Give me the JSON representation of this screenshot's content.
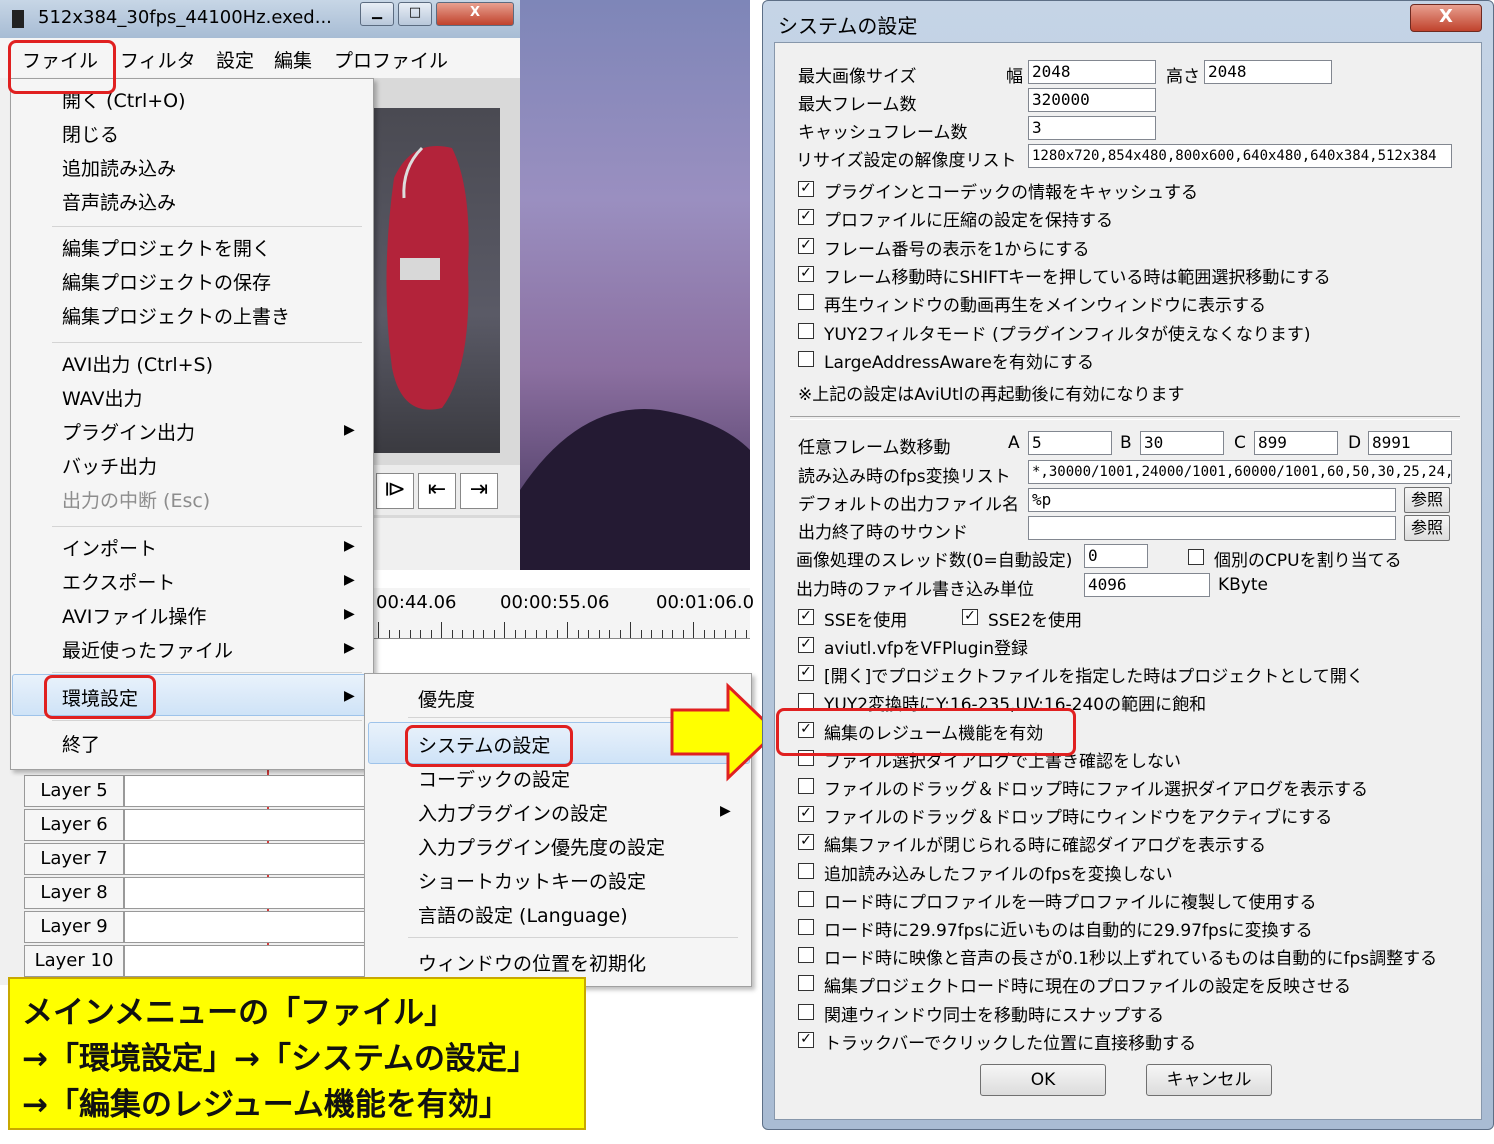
{
  "main_window": {
    "title": "512x384_30fps_44100Hz.exed...",
    "min_btn": "▁",
    "max_btn": "□",
    "close_btn": "X",
    "menubar": [
      "ファイル",
      "フィルタ",
      "設定",
      "編集",
      "プロファイル"
    ]
  },
  "file_menu": {
    "items": [
      "開く (Ctrl+O)",
      "閉じる",
      "追加読み込み",
      "音声読み込み",
      "編集プロジェクトを開く",
      "編集プロジェクトの保存",
      "編集プロジェクトの上書き",
      "AVI出力 (Ctrl+S)",
      "WAV出力",
      "プラグイン出力",
      "バッチ出力",
      "出力の中断 (Esc)",
      "インポート",
      "エクスポート",
      "AVIファイル操作",
      "最近使ったファイル",
      "環境設定",
      "終了"
    ]
  },
  "submenu": {
    "items": [
      "優先度",
      "システムの設定",
      "コーデックの設定",
      "入力プラグインの設定",
      "入力プラグイン優先度の設定",
      "ショートカットキーの設定",
      "言語の設定 (Language)",
      "ウィンドウの位置を初期化"
    ]
  },
  "timeline": {
    "ruler_labels": [
      "00:44.06",
      "00:00:55.06",
      "00:01:06.0"
    ],
    "layers": [
      "Layer  5",
      "Layer  6",
      "Layer  7",
      "Layer  8",
      "Layer  9",
      "Layer 10"
    ]
  },
  "note": {
    "lines": [
      "メインメニューの「ファイル」",
      "→「環境設定」→「システムの設定」",
      "→「編集のレジューム機能を有効」"
    ]
  },
  "dialog": {
    "title": "システムの設定",
    "close": "X",
    "max_image_size_label": "最大画像サイズ",
    "width_label": "幅",
    "width_value": "2048",
    "height_label": "高さ",
    "height_value": "2048",
    "max_frames_label": "最大フレーム数",
    "max_frames_value": "320000",
    "cache_frames_label": "キャッシュフレーム数",
    "cache_frames_value": "3",
    "resize_list_label": "リサイズ設定の解像度リスト",
    "resize_list_value": "1280x720,854x480,800x600,640x480,640x384,512x384",
    "checks1": [
      {
        "label": "プラグインとコーデックの情報をキャッシュする",
        "checked": true
      },
      {
        "label": "プロファイルに圧縮の設定を保持する",
        "checked": true
      },
      {
        "label": "フレーム番号の表示を1からにする",
        "checked": true
      },
      {
        "label": "フレーム移動時にSHIFTキーを押している時は範囲選択移動にする",
        "checked": true
      },
      {
        "label": "再生ウィンドウの動画再生をメインウィンドウに表示する",
        "checked": false
      },
      {
        "label": "YUY2フィルタモード (プラグインフィルタが使えなくなります)",
        "checked": false
      },
      {
        "label": "LargeAddressAwareを有効にする",
        "checked": false
      }
    ],
    "restart_note": "※上記の設定はAviUtlの再起動後に有効になります",
    "frame_move_label": "任意フレーム数移動",
    "a_label": "A",
    "a_value": "5",
    "b_label": "B",
    "b_value": "30",
    "c_label": "C",
    "c_value": "899",
    "d_label": "D",
    "d_value": "8991",
    "fps_list_label": "読み込み時のfps変換リスト",
    "fps_list_value": "*,30000/1001,24000/1001,60000/1001,60,50,30,25,24,:",
    "default_out_label": "デフォルトの出力ファイル名",
    "default_out_value": "%p",
    "ref_btn": "参照",
    "end_sound_label": "出力終了時のサウンド",
    "end_sound_value": "",
    "threads_label": "画像処理のスレッド数(0=自動設定)",
    "threads_value": "0",
    "cpu_assign_label": "個別のCPUを割り当てる",
    "write_unit_label": "出力時のファイル書き込み単位",
    "write_unit_value": "4096",
    "write_unit_suffix": "KByte",
    "sse_label": "SSEを使用",
    "sse2_label": "SSE2を使用",
    "checks2": [
      {
        "label": "aviutl.vfpをVFPlugin登録",
        "checked": true
      },
      {
        "label": "[開く]でプロジェクトファイルを指定した時はプロジェクトとして開く",
        "checked": true
      },
      {
        "label": "YUY2変換時にY:16-235,UV:16-240の範囲に飽和",
        "checked": false
      },
      {
        "label": "編集のレジューム機能を有効",
        "checked": true
      },
      {
        "label": "ファイル選択ダイアログで上書き確認をしない",
        "checked": false
      },
      {
        "label": "ファイルのドラッグ＆ドロップ時にファイル選択ダイアログを表示する",
        "checked": false
      },
      {
        "label": "ファイルのドラッグ＆ドロップ時にウィンドウをアクティブにする",
        "checked": true
      },
      {
        "label": "編集ファイルが閉じられる時に確認ダイアログを表示する",
        "checked": true
      },
      {
        "label": "追加読み込みしたファイルのfpsを変換しない",
        "checked": false
      },
      {
        "label": "ロード時にプロファイルを一時プロファイルに複製して使用する",
        "checked": false
      },
      {
        "label": "ロード時に29.97fpsに近いものは自動的に29.97fpsに変換する",
        "checked": false
      },
      {
        "label": "ロード時に映像と音声の長さが0.1秒以上ずれているものは自動的にfps調整する",
        "checked": false
      },
      {
        "label": "編集プロジェクトロード時に現在のプロファイルの設定を反映させる",
        "checked": false
      },
      {
        "label": "関連ウィンドウ同士を移動時にスナップする",
        "checked": false
      },
      {
        "label": "トラックバーでクリックした位置に直接移動する",
        "checked": true
      }
    ],
    "ok": "OK",
    "cancel": "キャンセル"
  }
}
